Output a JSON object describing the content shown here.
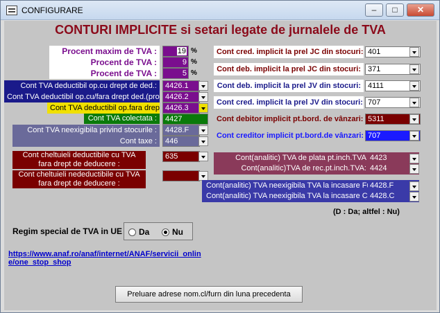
{
  "window": {
    "title": "CONFIGURARE"
  },
  "heading": "CONTURI IMPLICITE si setari legate de jurnalele de TVA",
  "percents": {
    "max_label": "Procent maxim de TVA :",
    "max_value": "19",
    "p2_label": "Procent de TVA :",
    "p2_value": "9",
    "p3_label": "Procent de TVA :",
    "p3_value": "5",
    "sign": "%"
  },
  "left_accounts": [
    {
      "label": "Cont TVA deductibil op.cu drept de ded.:",
      "value": "4426.1"
    },
    {
      "label": "Cont TVA deductibil op.cu/fara drept ded.(prorata)",
      "value": "4426.2"
    },
    {
      "label": "Cont TVA deductibil op.fara drept ded.",
      "value": "4426.3"
    },
    {
      "label": "Cont TVA colectata :",
      "value": "4427"
    },
    {
      "label": "Cont TVA neexigibila privind stocurile :",
      "value": "4428.F"
    },
    {
      "label": "Cont taxe :",
      "value": "446"
    }
  ],
  "expenses": [
    {
      "label": "Cont cheltuieli deductibile cu TVA fara drept de deducere :",
      "value": "635"
    },
    {
      "label": "Cont cheltuieli nedeductibile cu TVA fara drept de deducere :",
      "value": ""
    }
  ],
  "right_accounts": [
    {
      "label": "Cont cred. implicit la prel JC din stocuri:",
      "value": "401"
    },
    {
      "label": "Cont deb. implicit la prel JC din stocuri:",
      "value": "371"
    },
    {
      "label": "Cont deb. implicit la prel JV din stocuri:",
      "value": "4111"
    },
    {
      "label": "Cont cred. implicit la prel JV din stocuri:",
      "value": "707"
    },
    {
      "label": "Cont debitor implicit pt.bord. de vânzari:",
      "value": "5311"
    },
    {
      "label": "Cont creditor implicit pt.bord.de vânzari:",
      "value": "707"
    }
  ],
  "analytic": [
    {
      "label": "Cont(analitic) TVA de plata pt.inch.TVA",
      "value": "4423"
    },
    {
      "label": "Cont(analitic)TVA de rec.pt.inch.TVA:",
      "value": "4424"
    },
    {
      "label": "Cont(analitic) TVA neexigibila TVA la incasare Furnizori :",
      "value": "4428.F"
    },
    {
      "label": "Cont(analitic) TVA neexigibila TVA la incasare Clienti :",
      "value": "4428.C"
    }
  ],
  "note": "(D : Da; altfel : Nu)",
  "regime": {
    "label": "Regim special de TVA in UE",
    "option_da": "Da",
    "option_nu": "Nu",
    "selected": "Nu"
  },
  "link_line1": "https://www.anaf.ro/anaf/internet/ANAF/servicii_onlin",
  "link_line2": "e/one_stop_shop",
  "button_label": "Preluare adrese nom.cl/furn din luna precedenta",
  "colors": {
    "purple": "#7a0e8e",
    "dark_red": "#7a0000",
    "navy": "#1a1a8a",
    "yellow": "#f0e000",
    "green": "#0a7a0a",
    "slate": "#6a6a9a",
    "maroon_soft": "#8a3a5a",
    "blue_indigo": "#3a3aa8"
  }
}
